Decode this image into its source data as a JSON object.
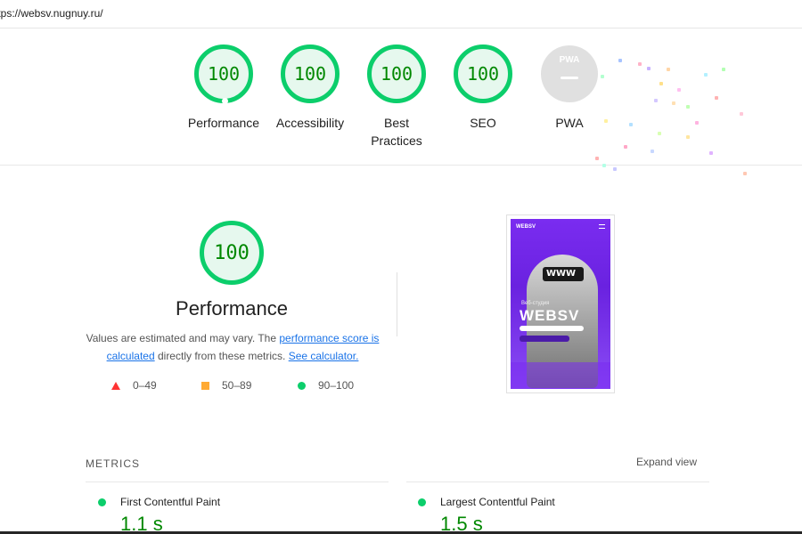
{
  "url": "ttps://websv.nugnuy.ru/",
  "summary": {
    "gauges": [
      {
        "score": "100",
        "label": "Performance"
      },
      {
        "score": "100",
        "label": "Accessibility"
      },
      {
        "score": "100",
        "label": "Best Practices"
      },
      {
        "score": "100",
        "label": "SEO"
      }
    ],
    "pwa": {
      "badge": "PWA",
      "label": "PWA"
    }
  },
  "performance": {
    "score": "100",
    "title": "Performance",
    "desc_1": "Values are estimated and may vary. The ",
    "link_score": "performance score is calculated",
    "desc_2": " directly from these metrics. ",
    "link_calc": "See calculator."
  },
  "legend": {
    "fail": "0–49",
    "average": "50–89",
    "pass": "90–100"
  },
  "screenshot": {
    "logo": "WEBSV",
    "www": "WWW",
    "subtitle": "Веб-студия",
    "title": "WEBSV"
  },
  "metrics": {
    "title": "METRICS",
    "expand": "Expand view",
    "items": [
      {
        "label": "First Contentful Paint",
        "value": "1.1 s"
      },
      {
        "label": "Largest Contentful Paint",
        "value": "1.5 s"
      }
    ]
  },
  "colors": {
    "pass": "#0cce6b",
    "pass_text": "#008800",
    "fail": "#ff3333",
    "average": "#ffaa33",
    "link": "#1a73e8"
  }
}
